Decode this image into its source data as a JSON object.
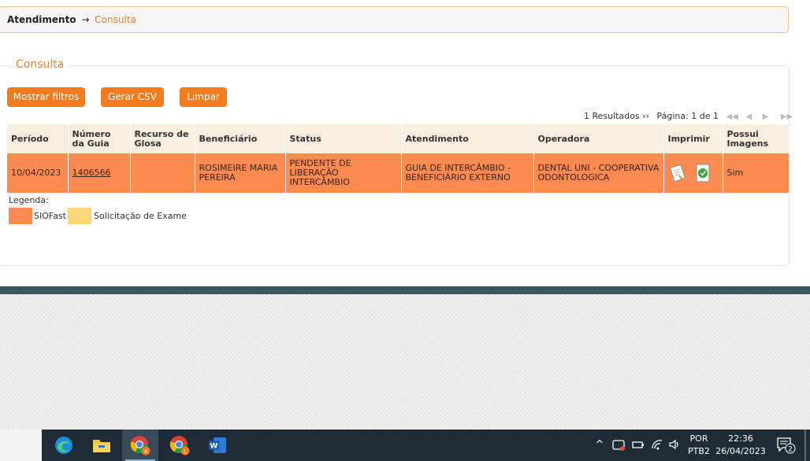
{
  "breadcrumb": {
    "root": "Atendimento",
    "arrow": "→",
    "current": "Consulta"
  },
  "panel": {
    "legend": "Consulta"
  },
  "buttons": {
    "filters": "Mostrar filtros",
    "csv": "Gerar CSV",
    "clear": "Limpar"
  },
  "pager": {
    "results": "1 Resultados ››",
    "page_info": "Página: 1 de 1",
    "first": "◀◀",
    "prev": "◀",
    "next": "▶",
    "last": "▶▶"
  },
  "table": {
    "headers": {
      "periodo": "Período",
      "numero_guia": "Número da Guia",
      "recurso_glosa": "Recurso de Glosa",
      "beneficiario": "Beneficiário",
      "status": "Status",
      "atendimento": "Atendimento",
      "operadora": "Operadora",
      "imprimir": "Imprimir",
      "possui_imagens": "Possui Imagens"
    },
    "rows": [
      {
        "periodo": "10/04/2023",
        "numero_guia": "1406566",
        "recurso_glosa": "",
        "beneficiario": "ROSIMEIRE MARIA PEREIRA",
        "status": "PENDENTE DE LIBERAÇÃO INTERCÂMBIO",
        "atendimento": "GUIA DE INTERCÂMBIO - BENEFICIÁRIO EXTERNO",
        "operadora": "DENTAL UNI - COOPERATIVA ODONTOLOGICA",
        "possui_imagens": "Sim"
      }
    ]
  },
  "legend": {
    "title": "Legenda:",
    "items": [
      {
        "label": "SIOFast",
        "color": "#fd8a50"
      },
      {
        "label": "Solicitação de Exame",
        "color": "#fcd67a"
      }
    ]
  },
  "taskbar": {
    "apps": [
      {
        "name": "edge-icon",
        "active": false
      },
      {
        "name": "file-explorer-icon",
        "active": false
      },
      {
        "name": "chrome-icon",
        "badge": "A",
        "active": true
      },
      {
        "name": "chrome-icon",
        "badge": "L",
        "active": false
      },
      {
        "name": "word-icon",
        "badge": "W",
        "active": false
      }
    ],
    "tray": {
      "chevron": "^",
      "lang_top": "POR",
      "lang_bottom": "PTB2",
      "time": "22:36",
      "date": "26/04/2023",
      "notifications": "2"
    }
  },
  "colors": {
    "accent": "#f57a1c",
    "row_highlight": "#fd8a50",
    "header_bg": "#faeee0",
    "taskbar": "#1f2b36"
  }
}
